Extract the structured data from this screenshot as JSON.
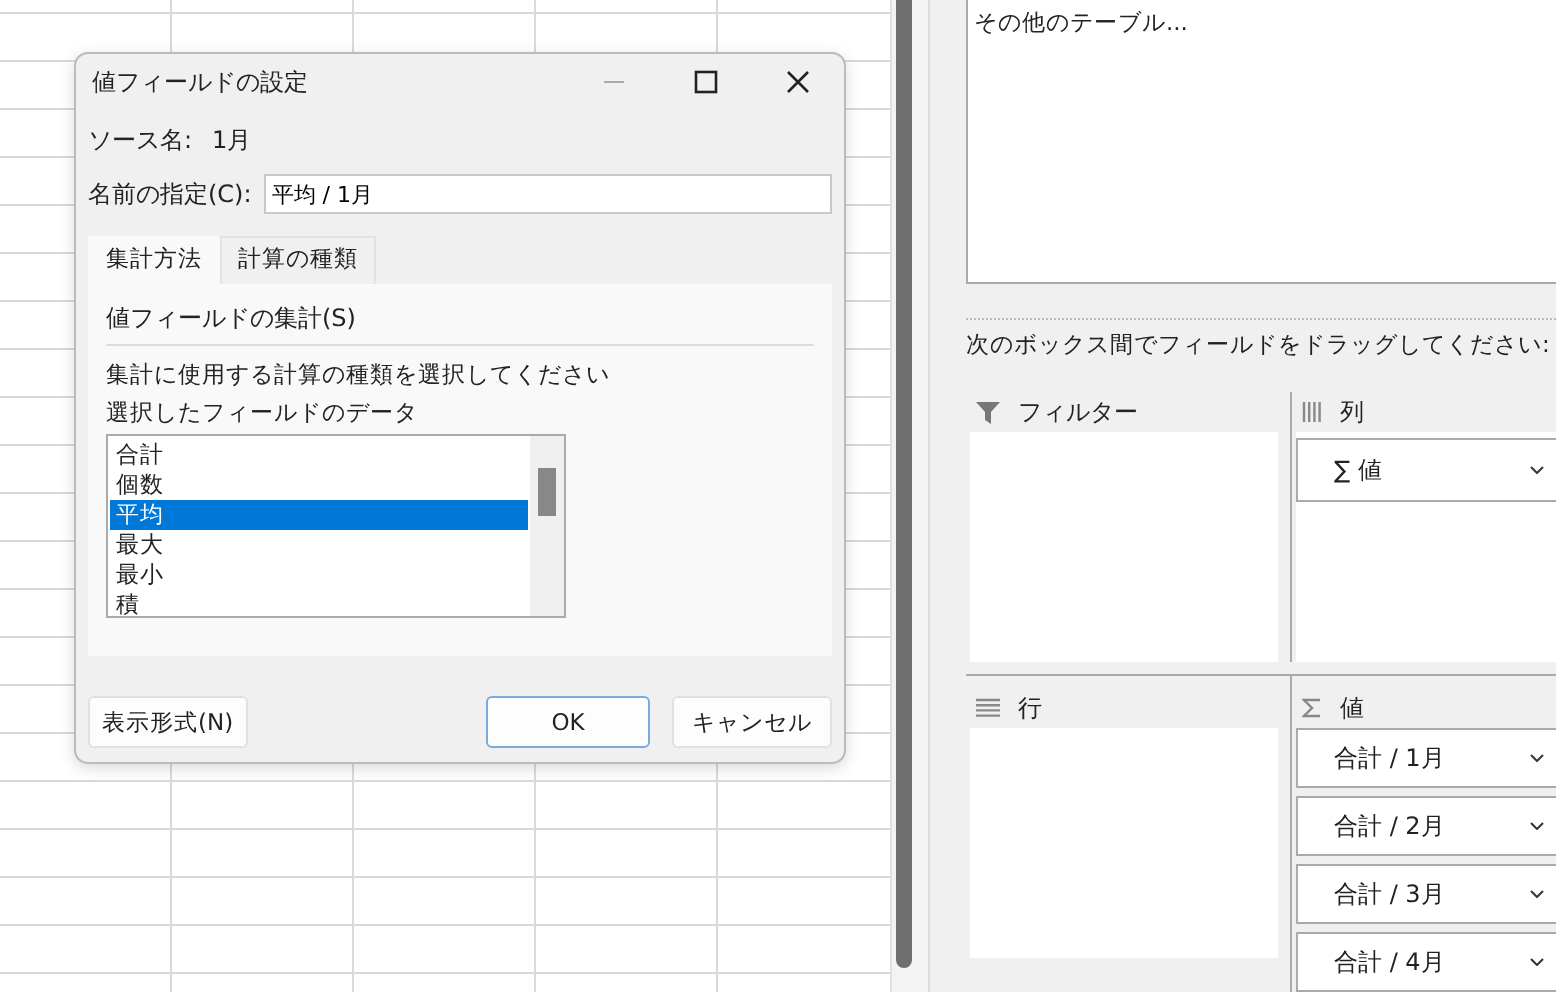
{
  "dialog": {
    "title": "値フィールドの設定",
    "source_label": "ソース名:",
    "source_value": "1月",
    "name_label": "名前の指定(C):",
    "name_value": "平均 / 1月",
    "tabs": [
      {
        "label": "集計方法",
        "selected": true
      },
      {
        "label": "計算の種類",
        "selected": false
      }
    ],
    "section_title": "値フィールドの集計(S)",
    "instruction": "集計に使用する計算の種類を選択してください",
    "list_label": "選択したフィールドのデータ",
    "functions": [
      {
        "label": "合計",
        "selected": false
      },
      {
        "label": "個数",
        "selected": false
      },
      {
        "label": "平均",
        "selected": true
      },
      {
        "label": "最大",
        "selected": false
      },
      {
        "label": "最小",
        "selected": false
      },
      {
        "label": "積",
        "selected": false
      }
    ],
    "format_button": "表示形式(N)",
    "ok_button": "OK",
    "cancel_button": "キャンセル"
  },
  "pivot_pane": {
    "more_tables": "その他のテーブル...",
    "drag_hint": "次のボックス間でフィールドをドラッグしてください:",
    "filters": {
      "label": "フィルター"
    },
    "columns": {
      "label": "列",
      "items": [
        "∑ 値"
      ]
    },
    "rows": {
      "label": "行"
    },
    "values": {
      "label": "値",
      "items": [
        "合計 / 1月",
        "合計 / 2月",
        "合計 / 3月",
        "合計 / 4月"
      ]
    }
  }
}
